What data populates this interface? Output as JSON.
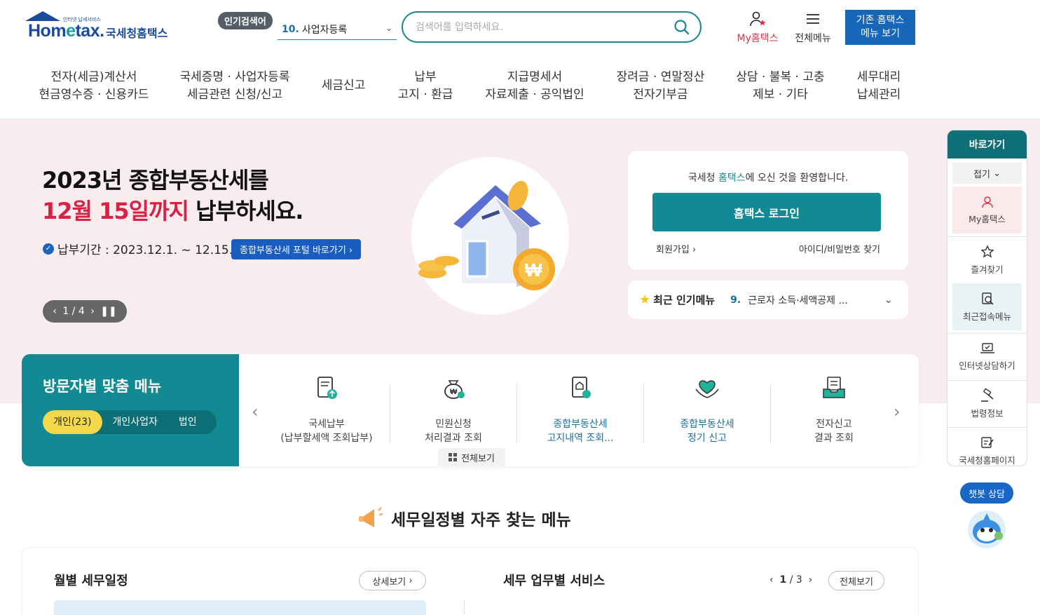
{
  "header": {
    "logo": {
      "brand_a": "Hom",
      "brand_e": "e",
      "brand_b": "tax.",
      "tag": "인터넷 납세서비스",
      "kname": "국세청홈택스"
    },
    "popular_badge": "인기검색어",
    "popular_num": "10.",
    "popular_text": "사업자등록",
    "search_placeholder": "검색어를 입력하세요.",
    "my_hometax": "My홈택스",
    "all_menu": "전체메뉴",
    "old_menu_line1": "기존 홈택스",
    "old_menu_line2": "메뉴 보기"
  },
  "gnb": [
    {
      "l1": "전자(세금)계산서",
      "l2": "현금영수증 · 신용카드"
    },
    {
      "l1": "국세증명 · 사업자등록",
      "l2": "세금관련 신청/신고"
    },
    {
      "l1": "세금신고",
      "l2": ""
    },
    {
      "l1": "납부",
      "l2": "고지 · 환급"
    },
    {
      "l1": "지급명세서",
      "l2": "자료제출 · 공익법인"
    },
    {
      "l1": "장려금 · 연말정산",
      "l2": "전자기부금"
    },
    {
      "l1": "상담 · 불복 · 고충",
      "l2": "제보 · 기타"
    },
    {
      "l1": "세무대리",
      "l2": "납세관리"
    }
  ],
  "hero": {
    "title1": "2023년 종합부동산세를",
    "title2_red": "12월 15일까지",
    "title2_rest": " 납부하세요.",
    "period": "납부기간 : 2023.12.1. ~ 12.15.",
    "link": "종합부동산세 포털 바로가기",
    "pager": "1 / 4"
  },
  "login": {
    "welcome_a": "국세청 ",
    "welcome_hl": "홈택스",
    "welcome_b": "에 오신 것을 환영합니다.",
    "button": "홈택스 로그인",
    "join": "회원가입",
    "find": "아이디/비밀번호 찾기"
  },
  "popular_menu": {
    "title": "최근 인기메뉴",
    "num": "9.",
    "text": "근로자 소득·세액공제 ..."
  },
  "visitor": {
    "title": "방문자별 맞춤 메뉴",
    "tabs": [
      "개인(23)",
      "개인사업자",
      "법인"
    ]
  },
  "cards": [
    {
      "l1": "국세납부",
      "l2": "(납부할세액 조회납부)",
      "blue": false
    },
    {
      "l1": "민원신청",
      "l2": "처리결과 조회",
      "blue": false
    },
    {
      "l1": "종합부동산세",
      "l2": "고지내역 조회...",
      "blue": true
    },
    {
      "l1": "종합부동산세",
      "l2": "정기 신고",
      "blue": true
    },
    {
      "l1": "전자신고",
      "l2": "결과 조회",
      "blue": false
    }
  ],
  "view_all": "전체보기",
  "section_title": "세무일정별 자주 찾는 메뉴",
  "bottom": {
    "left_title": "월별 세무일정",
    "detail": "상세보기",
    "right_title": "세무 업무별 서비스",
    "page_cur": "1",
    "page_total": "/ 3",
    "all": "전체보기"
  },
  "quick": {
    "head": "바로가기",
    "fold": "접기",
    "items": [
      "My홈택스",
      "즐겨찾기",
      "최근접속메뉴",
      "인터넷상담하기",
      "법령정보",
      "국세청홈페이지"
    ]
  },
  "chatbot": "챗봇 상담",
  "colors": {
    "primary": "#118a93",
    "accent_red": "#d92145",
    "link_blue": "#1a5dbf"
  }
}
